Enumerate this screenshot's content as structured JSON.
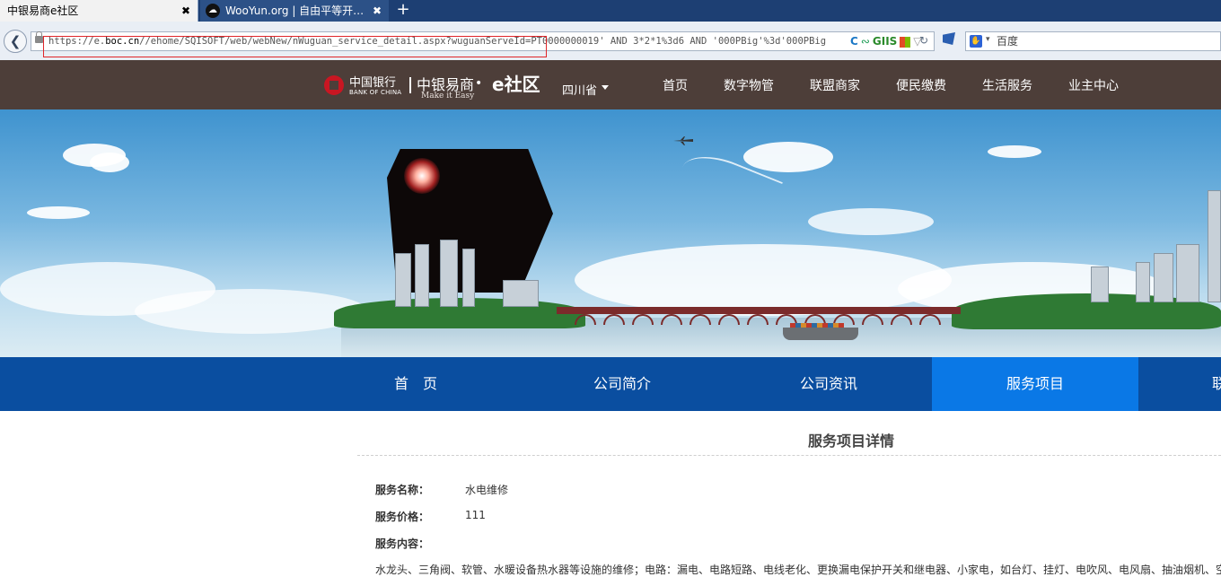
{
  "browser": {
    "tabs": [
      {
        "label": "中银易商e社区",
        "active": true
      },
      {
        "label": "WooYun.org | 自由平等开…",
        "active": false
      }
    ],
    "new_tab_label": "+",
    "close_glyph": "✖",
    "url": {
      "scheme": "https://e.",
      "host": "boc.cn",
      "path": "//ehome/SQISOFT/web/webNew/nWuguan_service_detail.aspx?wuguanServeId=PT0000000019' AND 3*2*1%3d6 AND '000PBig'%3d'000PBig"
    },
    "search_engine_label": "百度",
    "toolbar_badge": "GIIS"
  },
  "site": {
    "bank_name_cn": "中国银行",
    "bank_name_en": "BANK OF CHINA",
    "brand_cn": "中银易商",
    "brand_en": "Make it Easy",
    "brand_suffix": "e社区",
    "province": "四川省",
    "top_nav": [
      "首页",
      "数字物管",
      "联盟商家",
      "便民缴费",
      "生活服务",
      "业主中心"
    ],
    "sub_nav": [
      "首　页",
      "公司简介",
      "公司资讯",
      "服务项目",
      "联"
    ],
    "sub_nav_active_index": 3
  },
  "detail": {
    "title": "服务项目详情",
    "fields": [
      {
        "label": "服务名称：",
        "value": "水电维修"
      },
      {
        "label": "服务价格：",
        "value": "111"
      },
      {
        "label": "服务内容：",
        "value": ""
      }
    ],
    "description": "水龙头、三角阀、软管、水暖设备热水器等设施的维修；电路：漏电、电路短路、电线老化、更换漏电保护开关和继电器、小家电，如台灯、挂灯、电吹风、电风扇、抽油烟机、空"
  },
  "colors": {
    "header_bg": "#4d3e39",
    "subnav_bg": "#0a4ea0",
    "subnav_active": "#0a78e6",
    "highlight_box": "#e0262a"
  },
  "icons": {
    "back": "back-arrow-icon",
    "lock": "lock-icon",
    "reload": "reload-icon",
    "search": "baidu-paw-icon",
    "plane": "plane-icon"
  }
}
